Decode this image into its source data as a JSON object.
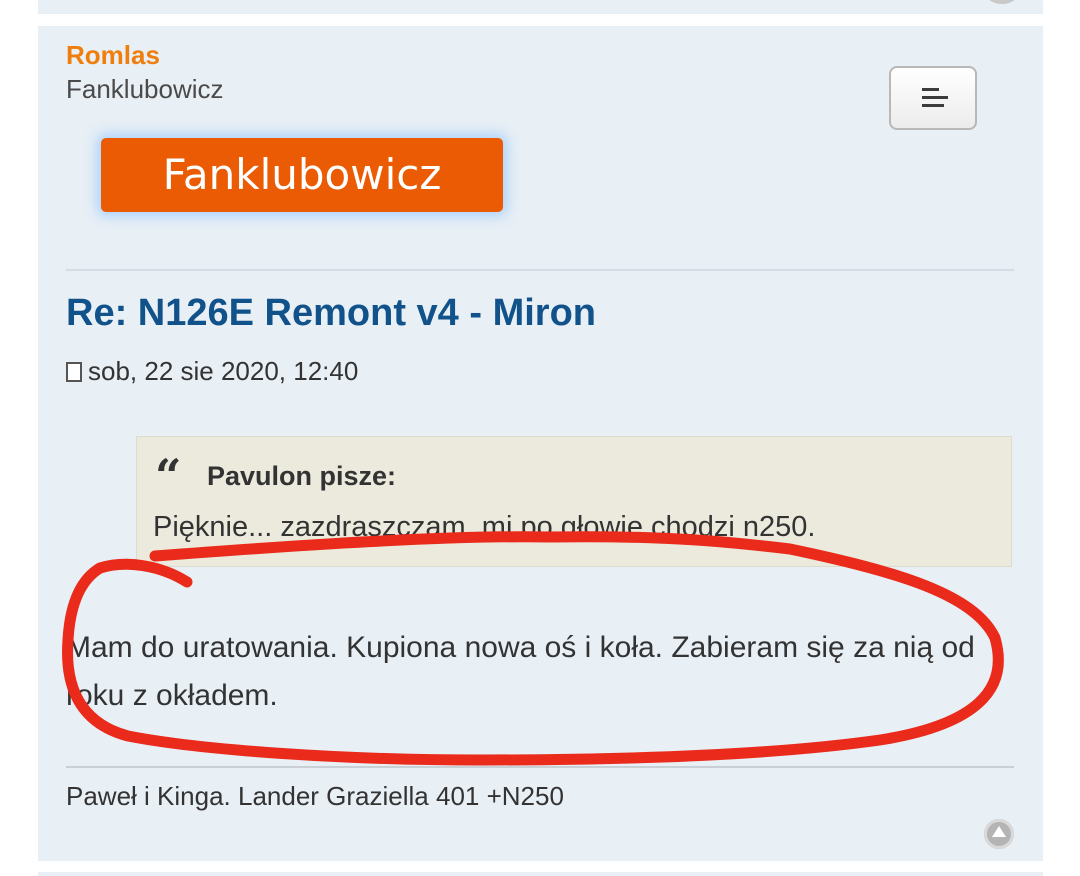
{
  "post": {
    "author": "Romlas",
    "rank": "Fanklubowicz",
    "rank_badge": "Fanklubowicz",
    "title": "Re: N126E Remont v4 - Miron",
    "date": "sob, 22 sie 2020, 12:40",
    "quote": {
      "mark": "“",
      "author": "Pavulon pisze:",
      "text": "Pięknie... zazdraszczam, mi po głowie chodzi n250."
    },
    "body": "Mam do uratowania. Kupiona nowa oś i koła. Zabieram się za nią od roku z okładem.",
    "signature": "Paweł i Kinga. Lander Graziella 401 +N250"
  },
  "icons": {
    "menu": "hamburger-menu-icon",
    "post_link": "document-icon",
    "back_to_top": "arrow-up-circle-icon"
  },
  "colors": {
    "post_bg": "#e8eff5",
    "author": "#f07e0c",
    "title": "#105289",
    "badge": "#ea5b04",
    "quote_bg": "#ebeadd",
    "annotation": "#ea2a1a"
  }
}
